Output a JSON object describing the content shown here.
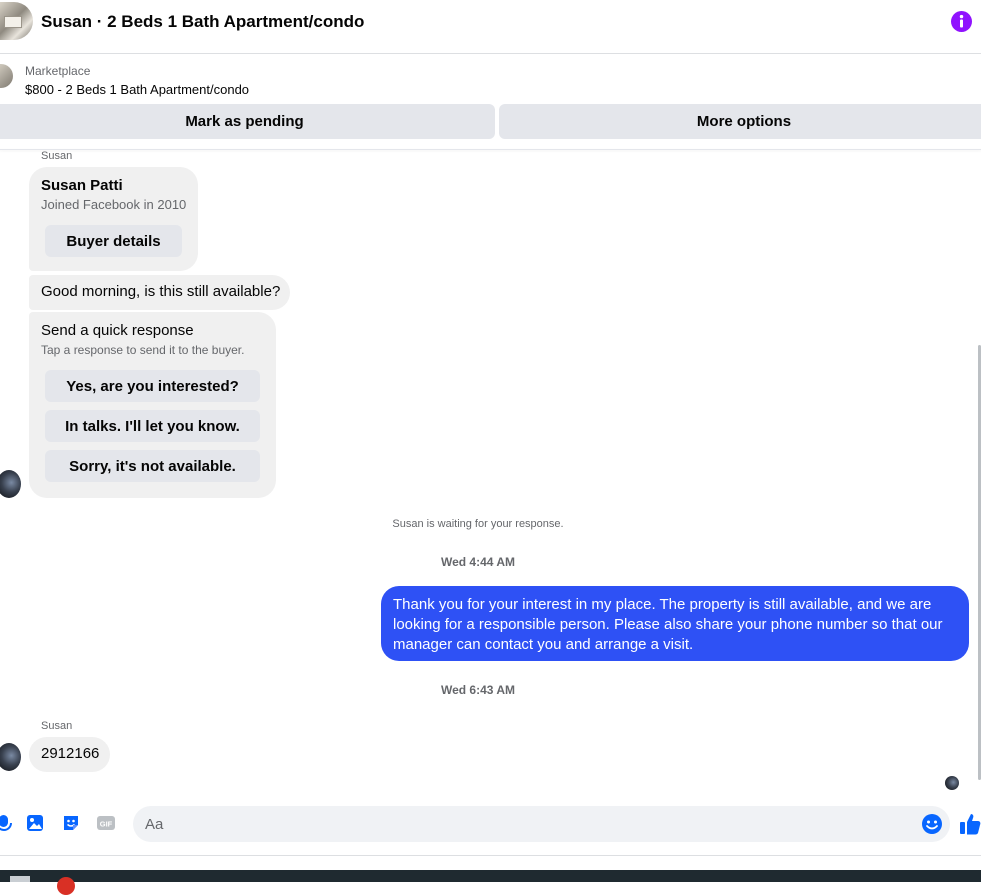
{
  "header": {
    "title": "Susan · 2 Beds 1 Bath Apartment/condo",
    "info_icon": "info-icon",
    "accent_color": "#9012fe"
  },
  "listing": {
    "source": "Marketplace",
    "title": "$800 - 2 Beds 1 Bath Apartment/condo"
  },
  "actions": {
    "pending_label": "Mark as pending",
    "more_label": "More options"
  },
  "conversation": {
    "sender_top": "Susan",
    "buyer_card": {
      "name": "Susan Patti",
      "joined": "Joined Facebook in 2010",
      "details_button": "Buyer details"
    },
    "first_message": "Good morning, is this still available?",
    "quick_response": {
      "title": "Send a quick response",
      "subtitle": "Tap a response to send it to the buyer.",
      "options": [
        "Yes, are you interested?",
        "In talks. I'll let you know.",
        "Sorry, it's not available."
      ]
    },
    "waiting_note": "Susan is waiting for your response.",
    "timestamp_1": "Wed 4:44 AM",
    "sent_message": "Thank you for your interest in my place. The property is still available, and we are looking for a responsible person. Please also share your phone number so that our manager can contact you and arrange a visit.",
    "timestamp_2": "Wed 6:43 AM",
    "sender_bottom": "Susan",
    "last_message": "2912166"
  },
  "composer": {
    "placeholder": "Aa",
    "icons": [
      "microphone-icon",
      "photo-icon",
      "sticker-icon",
      "gif-icon",
      "emoji-icon",
      "thumbs-up-icon"
    ],
    "brand_color": "#0866ff",
    "sent_bubble_color": "#2e51f5"
  }
}
